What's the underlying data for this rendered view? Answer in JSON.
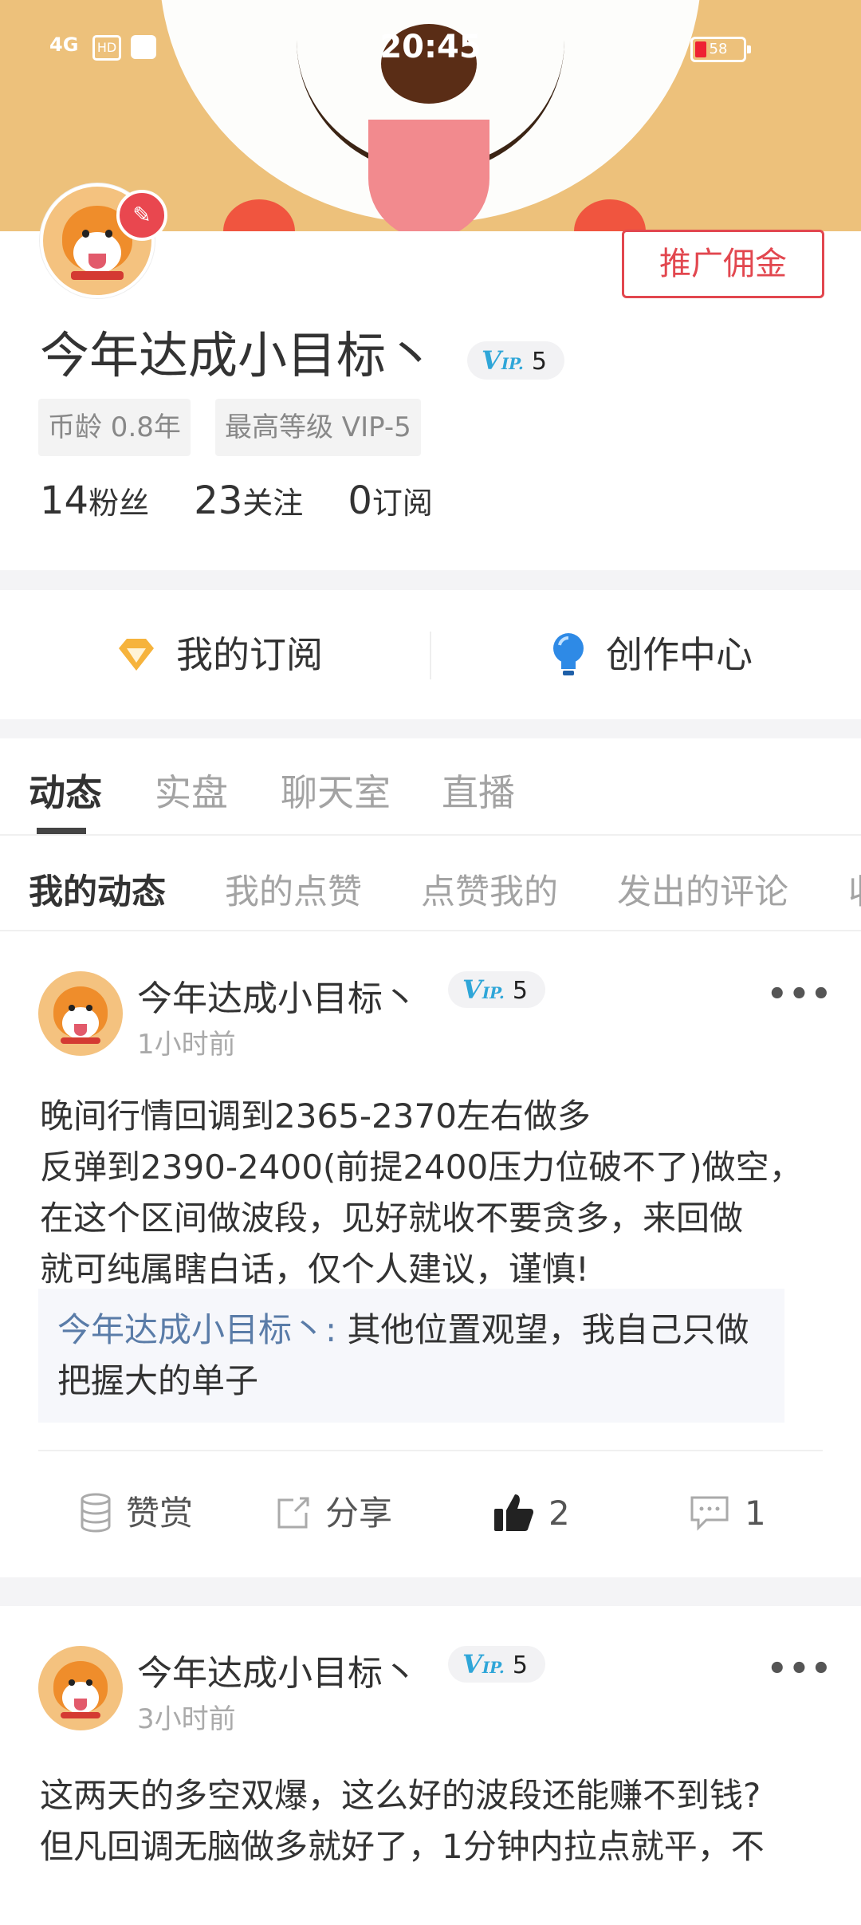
{
  "status_bar": {
    "time": "20:45",
    "signal": "4G",
    "hd": "HD",
    "battery": "58"
  },
  "profile": {
    "username": "今年达成小目标丶",
    "vip_level": "5",
    "vip_label": "V",
    "vip_sub": "IP.",
    "promo_button": "推广佣金",
    "tags": [
      "币龄 0.8年",
      "最高等级 VIP-5"
    ],
    "stats": [
      {
        "value": "14",
        "label": "粉丝"
      },
      {
        "value": "23",
        "label": "关注"
      },
      {
        "value": "0",
        "label": "订阅"
      }
    ]
  },
  "entries": [
    {
      "label": "我的订阅",
      "icon": "diamond-icon"
    },
    {
      "label": "创作中心",
      "icon": "bulb-icon"
    }
  ],
  "main_tabs": [
    "动态",
    "实盘",
    "聊天室",
    "直播"
  ],
  "sub_tabs": [
    "我的动态",
    "我的点赞",
    "点赞我的",
    "发出的评论",
    "收"
  ],
  "posts": [
    {
      "author": "今年达成小目标丶",
      "vip_level": "5",
      "time": "1小时前",
      "content_lines": [
        "晚间行情回调到2365-2370左右做多",
        "反弹到2390-2400(前提2400压力位破不了)做空，",
        "在这个区间做波段，见好就收不要贪多，来回做",
        "就可纯属瞎白话，仅个人建议，谨慎!"
      ],
      "quote_author": "今年达成小目标丶",
      "quote_sep": ":",
      "quote_text": " 其他位置观望，我自己只做把握大的单子",
      "actions": {
        "reward": "赞赏",
        "share": "分享",
        "likes": "2",
        "comments": "1"
      }
    },
    {
      "author": "今年达成小目标丶",
      "vip_level": "5",
      "time": "3小时前",
      "content_lines": [
        "这两天的多空双爆，这么好的波段还能赚不到钱?",
        "但凡回调无脑做多就好了，1分钟内拉点就平，不"
      ]
    }
  ],
  "colors": {
    "accent_red": "#e2474f",
    "vip_blue": "#2fa6d8",
    "banner": "#edc17b",
    "quote_name": "#5a7ca8"
  }
}
